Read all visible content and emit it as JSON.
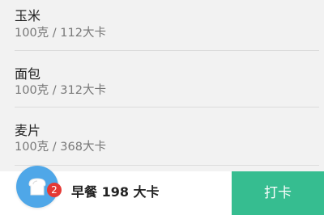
{
  "food_list": {
    "items": [
      {
        "name": "玉米",
        "detail": "100克 / 112大卡"
      },
      {
        "name": "面包",
        "detail": "100克 / 312大卡"
      },
      {
        "name": "麦片",
        "detail": "100克 / 368大卡"
      }
    ]
  },
  "bottom_bar": {
    "meal_icon": "bread-icon",
    "badge_count": "2",
    "summary": "早餐 198 大卡",
    "checkin_label": "打卡",
    "accent_color": "#36bd90",
    "icon_bg_color": "#4fa7e8",
    "badge_color": "#e53935"
  }
}
